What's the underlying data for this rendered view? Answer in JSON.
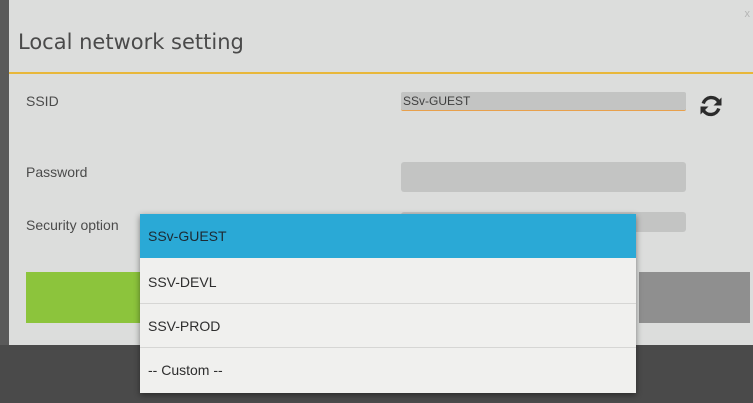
{
  "dialog": {
    "title": "Local network setting",
    "close_glyph": "x"
  },
  "ssid": {
    "label": "SSID",
    "value": "SSv-GUEST",
    "refresh_icon": "refresh-icon"
  },
  "password": {
    "label": "Password",
    "value": ""
  },
  "security": {
    "label": "Security option"
  },
  "dropdown": {
    "options": [
      {
        "label": "SSv-GUEST",
        "selected": true
      },
      {
        "label": "SSV-DEVL",
        "selected": false
      },
      {
        "label": "SSV-PROD",
        "selected": false
      },
      {
        "label": "-- Custom --",
        "selected": false
      }
    ]
  },
  "colors": {
    "accent_divider": "#e8b73a",
    "primary_button": "#8cc43c",
    "selected_option": "#2aa9d6",
    "secondary_button": "#8f8f8f"
  }
}
